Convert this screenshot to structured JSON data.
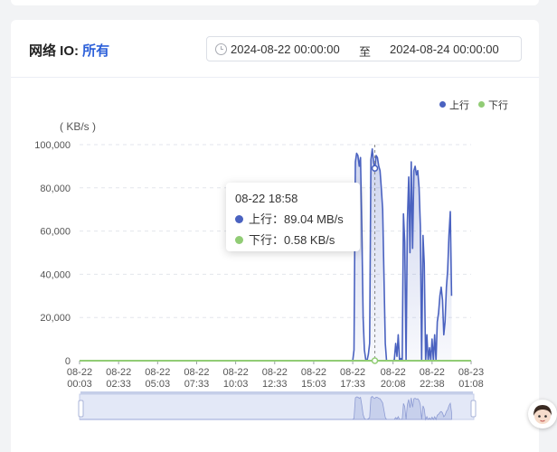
{
  "header": {
    "title_prefix": "网络 IO: ",
    "filter_link": "所有",
    "date_start": "2024-08-22 00:00:00",
    "date_separator": "至",
    "date_end": "2024-08-24 00:00:00"
  },
  "legend": {
    "upload": "上行",
    "download": "下行"
  },
  "tooltip": {
    "time": "08-22 18:58",
    "upload_label": "上行：",
    "upload_value": "89.04 MB/s",
    "download_label": "下行：",
    "download_value": "0.58 KB/s"
  },
  "colors": {
    "upload": "#4a62c0",
    "download": "#91cc75",
    "link": "#2b5fd9"
  },
  "chart_data": {
    "type": "area",
    "ylabel": "( KB/s )",
    "ylim": [
      0,
      100000
    ],
    "yticks": [
      "0",
      "20,000",
      "40,000",
      "60,000",
      "80,000",
      "100,000"
    ],
    "xticks": [
      "08-22 00:03",
      "08-22 02:33",
      "08-22 05:03",
      "08-22 07:33",
      "08-22 10:03",
      "08-22 12:33",
      "08-22 15:03",
      "08-22 17:33",
      "08-22 20:08",
      "08-22 22:38",
      "08-23 01:08"
    ],
    "grid": true,
    "legend_position": "top-right",
    "x_start": "08-22 00:03",
    "x_end": "08-23 01:08",
    "series": [
      {
        "name": "上行",
        "color": "#4a62c0",
        "points": [
          [
            "08-22 00:03",
            0
          ],
          [
            "08-22 17:33",
            0
          ],
          [
            "08-22 17:38",
            5000
          ],
          [
            "08-22 17:43",
            92000
          ],
          [
            "08-22 17:48",
            96000
          ],
          [
            "08-22 17:53",
            95000
          ],
          [
            "08-22 17:58",
            90000
          ],
          [
            "08-22 18:03",
            94000
          ],
          [
            "08-22 18:08",
            60000
          ],
          [
            "08-22 18:13",
            20000
          ],
          [
            "08-22 18:18",
            5000
          ],
          [
            "08-22 18:23",
            500
          ],
          [
            "08-22 18:28",
            0
          ],
          [
            "08-22 18:33",
            3000
          ],
          [
            "08-22 18:38",
            8000
          ],
          [
            "08-22 18:43",
            93000
          ],
          [
            "08-22 18:48",
            98000
          ],
          [
            "08-22 18:53",
            92000
          ],
          [
            "08-22 18:58",
            89040
          ],
          [
            "08-22 19:03",
            95000
          ],
          [
            "08-22 19:08",
            94000
          ],
          [
            "08-22 19:13",
            90000
          ],
          [
            "08-22 19:18",
            88000
          ],
          [
            "08-22 19:23",
            80000
          ],
          [
            "08-22 19:28",
            70000
          ],
          [
            "08-22 19:33",
            40000
          ],
          [
            "08-22 19:38",
            8000
          ],
          [
            "08-22 19:43",
            0
          ],
          [
            "08-22 20:08",
            0
          ],
          [
            "08-22 20:13",
            500
          ],
          [
            "08-22 20:18",
            8000
          ],
          [
            "08-22 20:23",
            2000
          ],
          [
            "08-22 20:28",
            12000
          ],
          [
            "08-22 20:33",
            0
          ],
          [
            "08-22 20:38",
            1000
          ],
          [
            "08-22 20:43",
            0
          ],
          [
            "08-22 20:48",
            68000
          ],
          [
            "08-22 20:53",
            55000
          ],
          [
            "08-22 20:58",
            0
          ],
          [
            "08-22 21:03",
            64000
          ],
          [
            "08-22 21:08",
            85000
          ],
          [
            "08-22 21:13",
            50000
          ],
          [
            "08-22 21:18",
            92000
          ],
          [
            "08-22 21:23",
            52000
          ],
          [
            "08-22 21:28",
            88000
          ],
          [
            "08-22 21:33",
            90000
          ],
          [
            "08-22 21:38",
            86000
          ],
          [
            "08-22 21:43",
            88000
          ],
          [
            "08-22 21:48",
            80000
          ],
          [
            "08-22 21:53",
            62000
          ],
          [
            "08-22 21:58",
            0
          ],
          [
            "08-22 22:03",
            58000
          ],
          [
            "08-22 22:08",
            45000
          ],
          [
            "08-22 22:13",
            0
          ],
          [
            "08-22 22:18",
            12000
          ],
          [
            "08-22 22:23",
            0
          ],
          [
            "08-22 22:28",
            6000
          ],
          [
            "08-22 22:33",
            0
          ],
          [
            "08-22 22:38",
            10000
          ],
          [
            "08-22 22:43",
            0
          ],
          [
            "08-22 22:48",
            12000
          ],
          [
            "08-22 22:53",
            0
          ],
          [
            "08-22 22:58",
            18000
          ],
          [
            "08-22 23:03",
            22000
          ],
          [
            "08-22 23:08",
            30000
          ],
          [
            "08-22 23:13",
            34000
          ],
          [
            "08-22 23:18",
            28000
          ],
          [
            "08-22 23:23",
            12000
          ],
          [
            "08-22 23:28",
            18000
          ],
          [
            "08-22 23:33",
            34000
          ],
          [
            "08-22 23:38",
            42000
          ],
          [
            "08-22 23:43",
            58000
          ],
          [
            "08-22 23:48",
            69000
          ],
          [
            "08-22 23:53",
            30000
          ]
        ]
      },
      {
        "name": "下行",
        "color": "#91cc75",
        "points": [
          [
            "08-22 00:03",
            0
          ],
          [
            "08-23 01:08",
            0
          ]
        ]
      }
    ]
  }
}
